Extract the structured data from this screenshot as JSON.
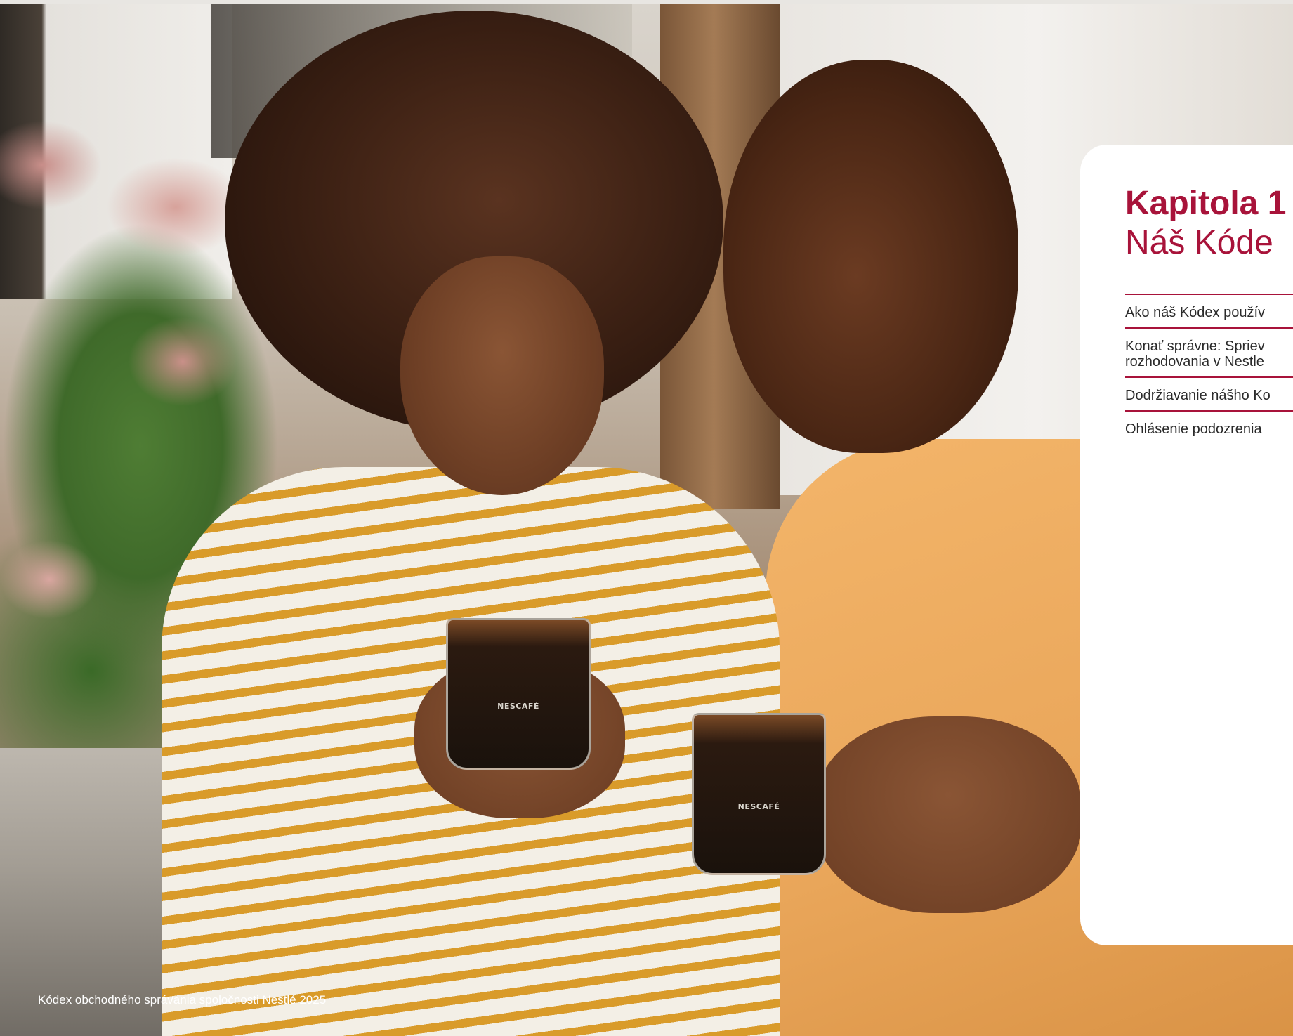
{
  "photo": {
    "cup_brand": "NESCAFÉ"
  },
  "card": {
    "chapter_label": "Kapitola 1",
    "chapter_title": "Náš Kóde",
    "toc": [
      "Ako náš Kódex použív",
      "Konať správne: Spriev\nrozhodovania v Nestle",
      "Dodržiavanie nášho Ko",
      "Ohlásenie podozrenia"
    ]
  },
  "footer": {
    "text": "Kódex obchodného správania spoločnosti Nestlé 2025"
  },
  "colors": {
    "accent": "#a8133a",
    "text": "#2a2a2a",
    "card_bg": "#ffffff"
  }
}
